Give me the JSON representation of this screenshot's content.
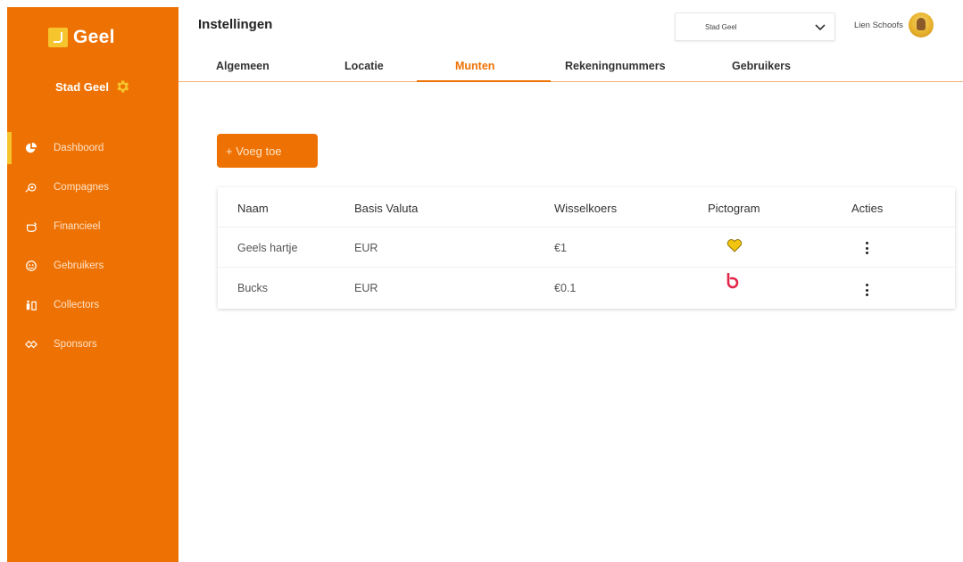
{
  "app": {
    "logo_text": "Geel",
    "org_name": "Stad Geel",
    "accent_color": "#ee7203",
    "logo_color": "#f6c42d"
  },
  "sidebar": {
    "items": [
      {
        "label": "Dashboord",
        "icon": "pie-chart-icon",
        "active": true
      },
      {
        "label": "Compagnes",
        "icon": "campaign-icon",
        "active": false
      },
      {
        "label": "Financieel",
        "icon": "piggy-bank-icon",
        "active": false
      },
      {
        "label": "Gebruikers",
        "icon": "smiley-icon",
        "active": false
      },
      {
        "label": "Collectors",
        "icon": "collectors-icon",
        "active": false
      },
      {
        "label": "Sponsors",
        "icon": "handshake-icon",
        "active": false
      }
    ]
  },
  "header": {
    "title": "Instellingen",
    "org_select_value": "Stad Geel",
    "user_name": "Lien Schoofs"
  },
  "tabs": [
    {
      "label": "Algemeen",
      "active": false
    },
    {
      "label": "Locatie",
      "active": false
    },
    {
      "label": "Munten",
      "active": true
    },
    {
      "label": "Rekeningnummers",
      "active": false
    },
    {
      "label": "Gebruikers",
      "active": false
    }
  ],
  "actions": {
    "add_label": "+ Voeg toe"
  },
  "table": {
    "columns": [
      "Naam",
      "Basis Valuta",
      "Wisselkoers",
      "Pictogram",
      "Acties"
    ],
    "rows": [
      {
        "naam": "Geels hartje",
        "valuta": "EUR",
        "koers": "€1",
        "pictogram": "heart-icon"
      },
      {
        "naam": "Bucks",
        "valuta": "EUR",
        "koers": "€0.1",
        "pictogram": "bucks-logo-icon"
      }
    ]
  }
}
